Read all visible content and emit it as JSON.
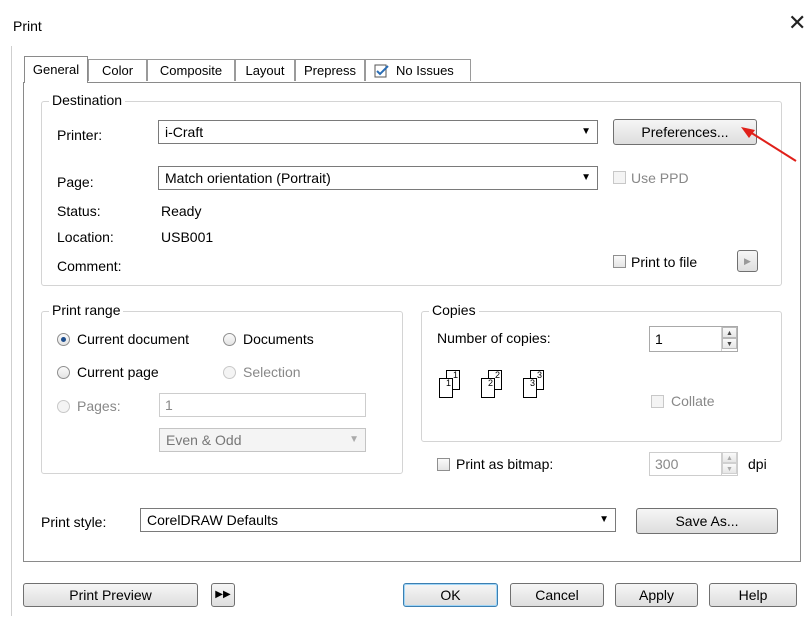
{
  "window": {
    "title": "Print",
    "close_glyph": "✕"
  },
  "tabs": [
    {
      "label": "General",
      "active": true
    },
    {
      "label": "Color"
    },
    {
      "label": "Composite"
    },
    {
      "label": "Layout"
    },
    {
      "label": "Prepress"
    },
    {
      "label": "No Issues",
      "icon": "checklist-icon"
    }
  ],
  "destination": {
    "legend": "Destination",
    "printer_label": "Printer:",
    "printer_value": "i-Craft",
    "preferences_button": "Preferences...",
    "page_label": "Page:",
    "page_value": "Match orientation (Portrait)",
    "use_ppd_label": "Use PPD",
    "status_label": "Status:",
    "status_value": "Ready",
    "location_label": "Location:",
    "location_value": "USB001",
    "comment_label": "Comment:",
    "print_to_file_label": "Print to file"
  },
  "print_range": {
    "legend": "Print range",
    "current_document": "Current document",
    "documents": "Documents",
    "current_page": "Current page",
    "selection": "Selection",
    "pages_label": "Pages:",
    "pages_value": "1",
    "even_odd_value": "Even & Odd",
    "selected": "current_document"
  },
  "copies": {
    "legend": "Copies",
    "number_label": "Number of copies:",
    "number_value": "1",
    "collate_label": "Collate",
    "collate_pages": [
      "1",
      "1",
      "2",
      "2",
      "3",
      "3"
    ]
  },
  "bitmap": {
    "label": "Print as bitmap:",
    "dpi_value": "300",
    "dpi_unit": "dpi"
  },
  "print_style": {
    "label": "Print style:",
    "value": "CorelDRAW Defaults",
    "save_as_button": "Save As..."
  },
  "footer": {
    "print_preview": "Print Preview",
    "ok": "OK",
    "cancel": "Cancel",
    "apply": "Apply",
    "help": "Help"
  },
  "colors": {
    "annotation_arrow": "#e0201a",
    "primary_button_border": "#3c7fb1"
  }
}
